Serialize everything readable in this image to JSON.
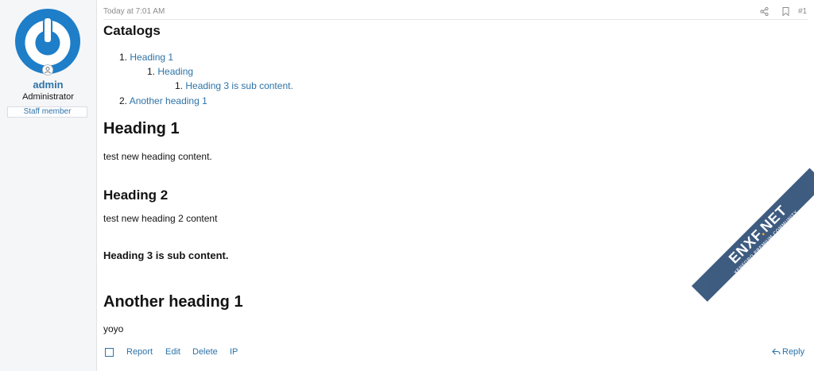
{
  "user": {
    "name": "admin",
    "title": "Administrator",
    "badge": "Staff member"
  },
  "post": {
    "time": "Today at 7:01 AM",
    "number": "#1",
    "catalog_title": "Catalogs",
    "toc": [
      {
        "num": "1.",
        "label": "Heading 1"
      },
      {
        "num": "1.",
        "label": "Heading"
      },
      {
        "num": "1.",
        "label": "Heading 3 is sub content."
      },
      {
        "num": "2.",
        "label": "Another heading 1"
      }
    ],
    "heading1": "Heading 1",
    "text1": "test new heading content.",
    "heading2": "Heading 2",
    "text2": "test new heading 2 content",
    "heading3": "Heading 3 is sub content.",
    "heading4": "Another heading 1",
    "text4": "yoyo"
  },
  "actions": {
    "report": "Report",
    "edit": "Edit",
    "delete": "Delete",
    "ip": "IP",
    "reply": "Reply"
  },
  "watermark": {
    "brand_a": "ENXF",
    "brand_dot": ".",
    "brand_b": "NET",
    "tagline": "XENFORO PREMIUM COMMUNITY"
  },
  "colors": {
    "link": "#2d73a8",
    "avatar": "#1e7ec8",
    "sidebar_bg": "#f5f6f8"
  }
}
